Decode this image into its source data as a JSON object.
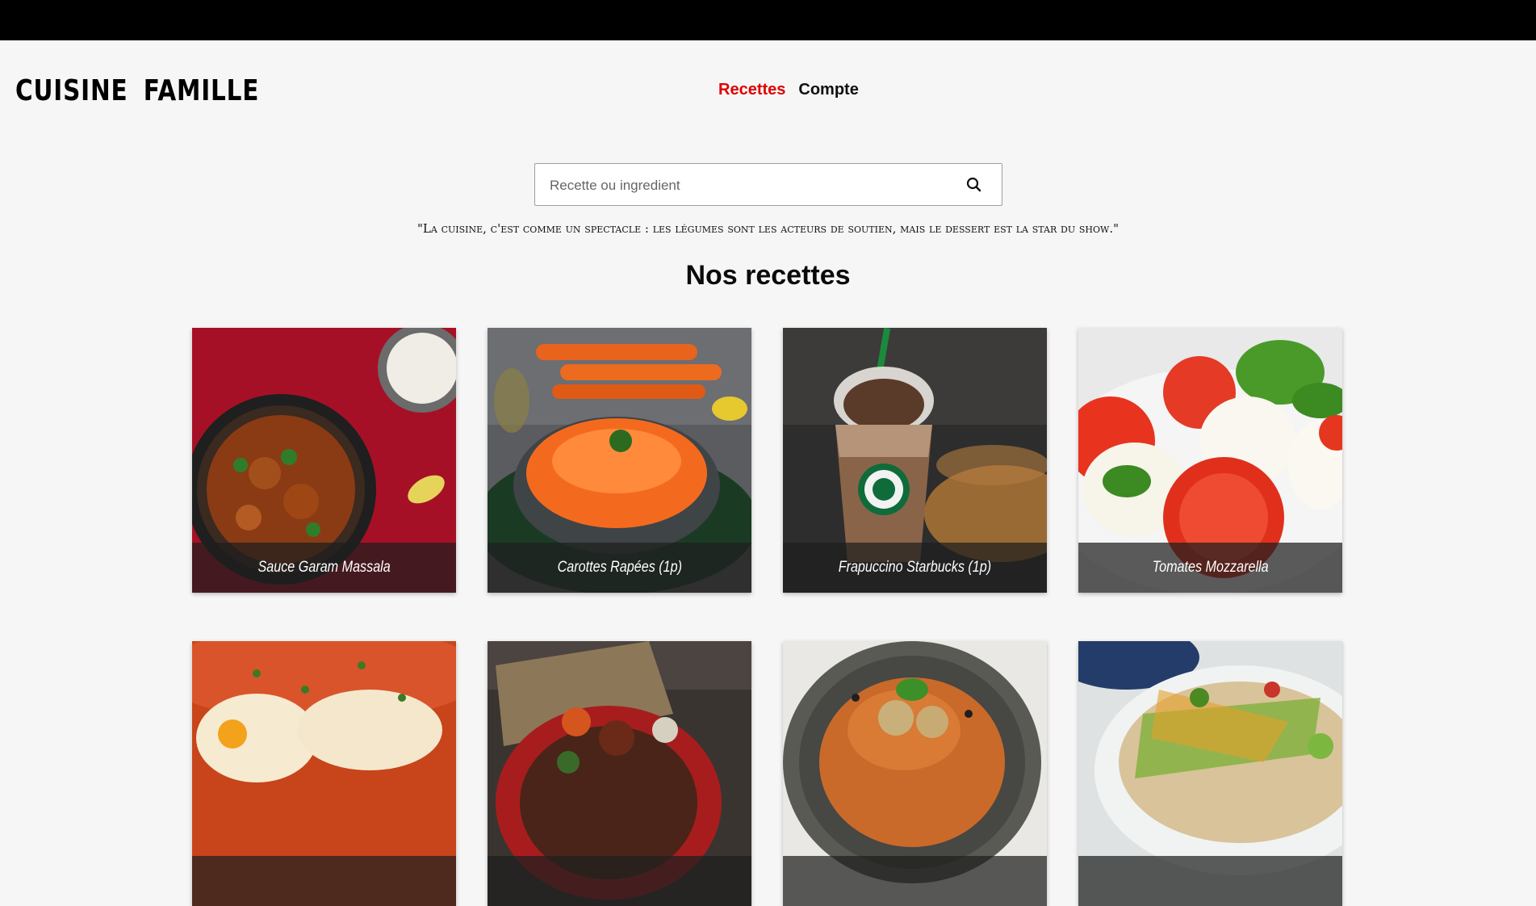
{
  "header": {
    "logo": "Cuisine Famille",
    "nav": [
      {
        "label": "Recettes",
        "active": true
      },
      {
        "label": "Compte",
        "active": false
      }
    ]
  },
  "search": {
    "placeholder": "Recette ou ingredient",
    "value": "",
    "icon": "search-icon"
  },
  "quote": "\"La cuisine, c'est comme un spectacle : les légumes sont les acteurs de soutien, mais le dessert est la star du show.\"",
  "section_title": "Nos recettes",
  "recipes": [
    {
      "title": "Sauce Garam Massala"
    },
    {
      "title": "Carottes Rapées (1p)"
    },
    {
      "title": "Frapuccino Starbucks (1p)"
    },
    {
      "title": "Tomates Mozzarella"
    },
    {
      "title": ""
    },
    {
      "title": ""
    },
    {
      "title": ""
    },
    {
      "title": ""
    }
  ],
  "colors": {
    "accent": "#e00000",
    "background": "#f6f6f6",
    "topbar": "#000000"
  }
}
